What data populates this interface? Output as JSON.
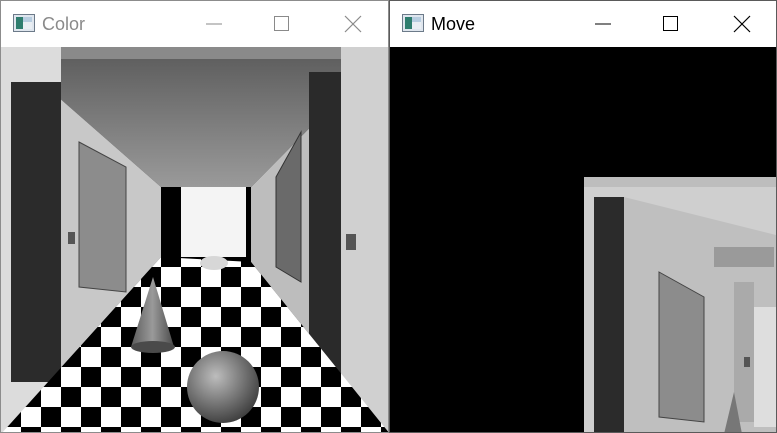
{
  "windows": [
    {
      "title": "Color",
      "state": "inactive",
      "icon": "opencv-image-window-icon",
      "controls": [
        "minimize-icon",
        "maximize-icon",
        "close-icon"
      ]
    },
    {
      "title": "Move",
      "state": "active",
      "icon": "opencv-image-window-icon",
      "controls": [
        "minimize-icon",
        "maximize-icon",
        "close-icon"
      ]
    }
  ],
  "colors": {
    "titlebar_bg": "#ffffff",
    "inactive_title": "#8a8a8a",
    "active_title": "#000000",
    "canvas_bg": "#000000"
  }
}
